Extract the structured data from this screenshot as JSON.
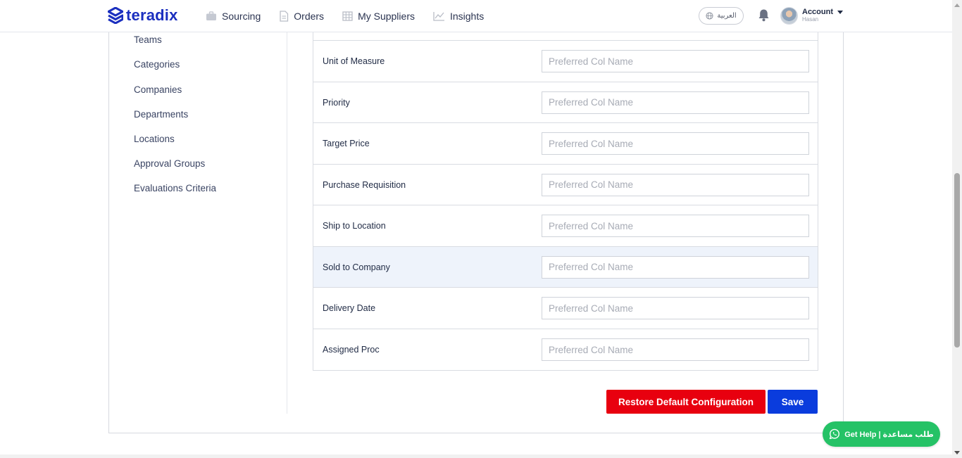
{
  "brand": {
    "name": "teradix",
    "color": "#1b2fbf"
  },
  "nav": {
    "items": [
      {
        "label": "Sourcing",
        "icon": "briefcase-icon"
      },
      {
        "label": "Orders",
        "icon": "document-icon"
      },
      {
        "label": "My Suppliers",
        "icon": "building-icon"
      },
      {
        "label": "Insights",
        "icon": "chart-icon"
      }
    ]
  },
  "header": {
    "language_label": "العربية",
    "account_label": "Account",
    "account_user": "Hasan"
  },
  "sidebar": {
    "items": [
      {
        "label": "Teams"
      },
      {
        "label": "Categories"
      },
      {
        "label": "Companies"
      },
      {
        "label": "Departments"
      },
      {
        "label": "Locations"
      },
      {
        "label": "Approval Groups"
      },
      {
        "label": "Evaluations Criteria"
      }
    ]
  },
  "config_table": {
    "placeholder": "Preferred Col Name",
    "highlighted_row": "Sold to Company",
    "rows": [
      {
        "label": "Unit of Measure",
        "value": ""
      },
      {
        "label": "Priority",
        "value": ""
      },
      {
        "label": "Target Price",
        "value": ""
      },
      {
        "label": "Purchase Requisition",
        "value": ""
      },
      {
        "label": "Ship to Location",
        "value": ""
      },
      {
        "label": "Sold to Company",
        "value": ""
      },
      {
        "label": "Delivery Date",
        "value": ""
      },
      {
        "label": "Assigned Proc",
        "value": ""
      }
    ]
  },
  "actions": {
    "restore_label": "Restore Default Configuration",
    "save_label": "Save"
  },
  "help": {
    "label": "Get Help | طلب مساعدة"
  },
  "colors": {
    "restore_button": "#e8000f",
    "save_button": "#0a3cdd",
    "help_button": "#25c266",
    "highlight_row": "#eef3fb"
  }
}
